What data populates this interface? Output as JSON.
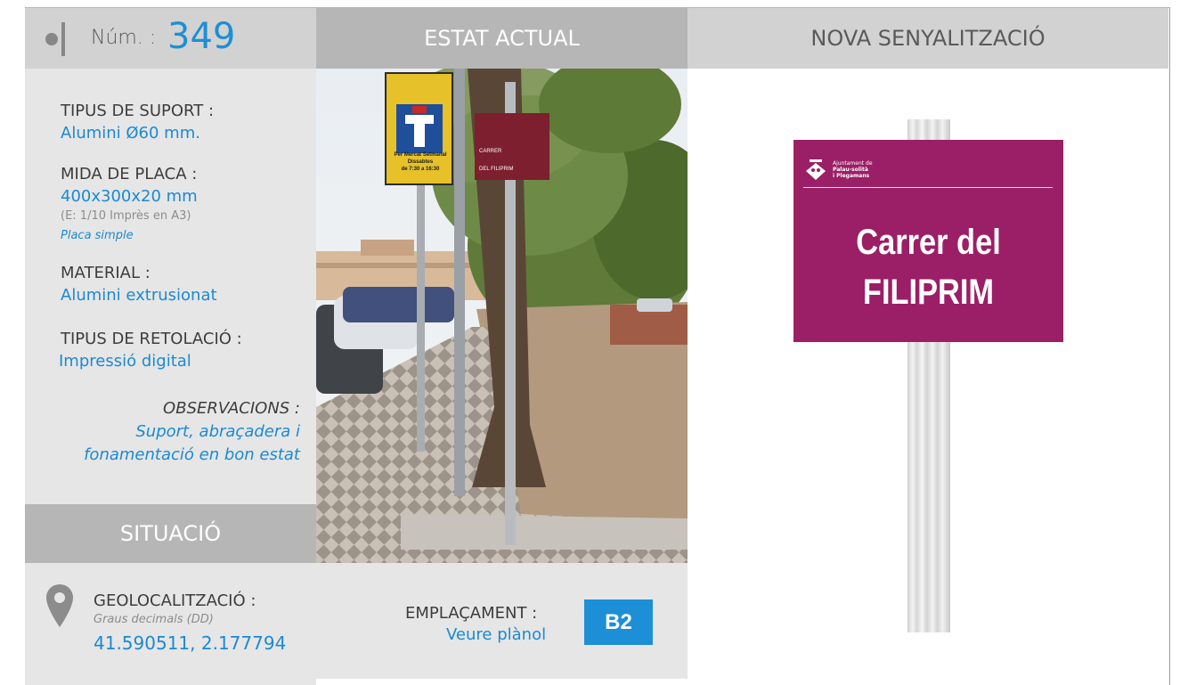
{
  "header": {
    "number_label": "Núm. :",
    "number_value": "349",
    "estat_actual": "ESTAT ACTUAL",
    "nova_senyalitzacio": "NOVA SENYALITZACIÓ"
  },
  "specs": {
    "suport_label": "TIPUS DE SUPORT :",
    "suport_value": "Alumini Ø60 mm.",
    "mida_label": "MIDA DE PLACA :",
    "mida_value": "400x300x20 mm",
    "mida_note": "(E: 1/10 Imprès en A3)",
    "mida_type": "Placa simple",
    "material_label": "MATERIAL :",
    "material_value": "Alumini extrusionat",
    "retolacio_label": "TIPUS DE RETOLACIÓ :",
    "retolacio_value": "Impressió digital",
    "observacions_label": "OBSERVACIONS :",
    "observacions_line1": "Suport, abraçadera i",
    "observacions_line2": "fonamentació en bon estat"
  },
  "situacio": {
    "title": "SITUACIÓ",
    "geo_label": "GEOLOCALITZACIÓ :",
    "geo_note": "Graus decimals (DD)",
    "geo_value": "41.590511, 2.177794",
    "emplacament_label": "EMPLAÇAMENT :",
    "emplacament_value": "Veure plànol",
    "grid_ref": "B2"
  },
  "photo": {
    "old_sign_line1": "CARRER",
    "old_sign_line2": "DEL FILIPRIM",
    "yellow_sign_line1": "Per Mercat Setmanal",
    "yellow_sign_line2": "Dissabtes",
    "yellow_sign_line3": "de 7:30 a 16:30"
  },
  "new_sign": {
    "logo_line1": "Ajuntament de",
    "logo_line2": "Palau-solità",
    "logo_line3": "i Plegamans",
    "title_line1": "Carrer del",
    "title_line2": "FILIPRIM"
  },
  "colors": {
    "accent_blue": "#1c8fd6",
    "plate_magenta": "#9b1f66",
    "header_grey": "#d2d2d2",
    "panel_grey": "#e6e6e6",
    "section_grey": "#b6b6b6"
  }
}
